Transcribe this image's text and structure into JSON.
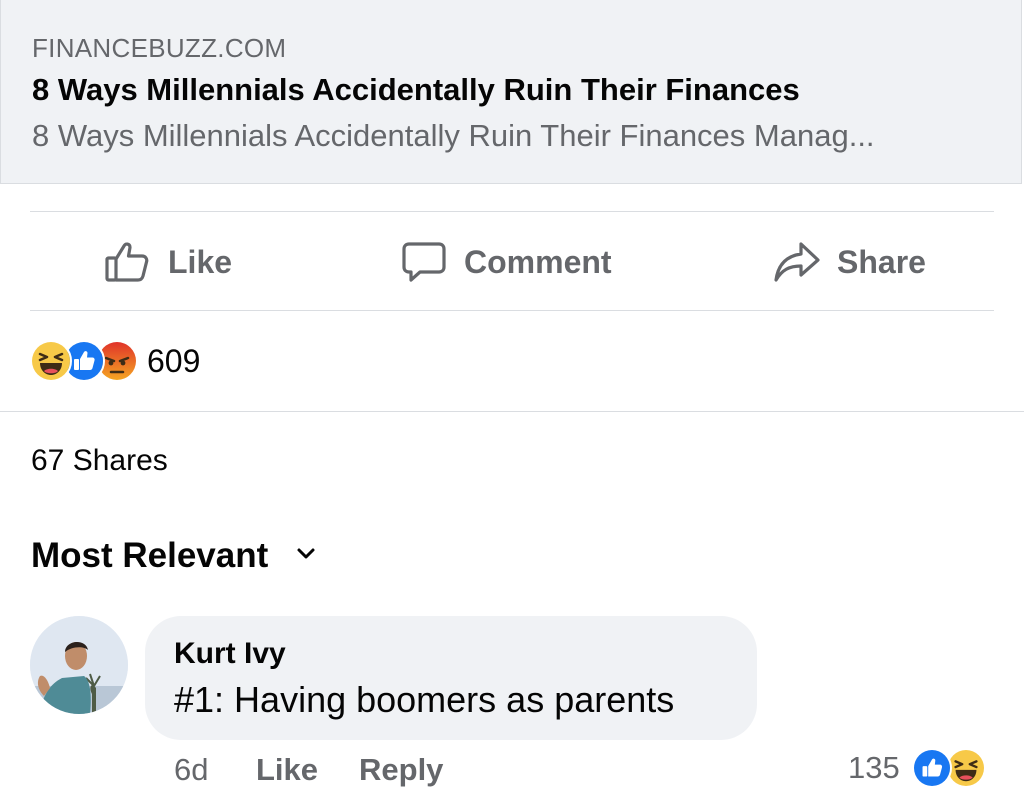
{
  "link_preview": {
    "domain": "FINANCEBUZZ.COM",
    "title": "8 Ways Millennials Accidentally Ruin Their Finances",
    "description": "8 Ways Millennials Accidentally Ruin Their Finances Manag..."
  },
  "actions": {
    "like_label": "Like",
    "comment_label": "Comment",
    "share_label": "Share"
  },
  "reactions": {
    "icons": [
      "haha-icon",
      "like-icon",
      "angry-icon"
    ],
    "count": "609"
  },
  "shares": {
    "label": "67 Shares"
  },
  "sort": {
    "label": "Most Relevant"
  },
  "comment": {
    "author": "Kurt Ivy",
    "text": "#1: Having boomers as parents",
    "time": "6d",
    "like_label": "Like",
    "reply_label": "Reply",
    "reaction_count": "135",
    "reaction_icons": [
      "like-icon",
      "haha-icon"
    ]
  },
  "colors": {
    "like_blue": "#1877f2",
    "haha_yellow": "#f7c948",
    "angry_red": "#e9710f",
    "muted_text": "#65676b",
    "bubble_bg": "#f0f2f5"
  }
}
